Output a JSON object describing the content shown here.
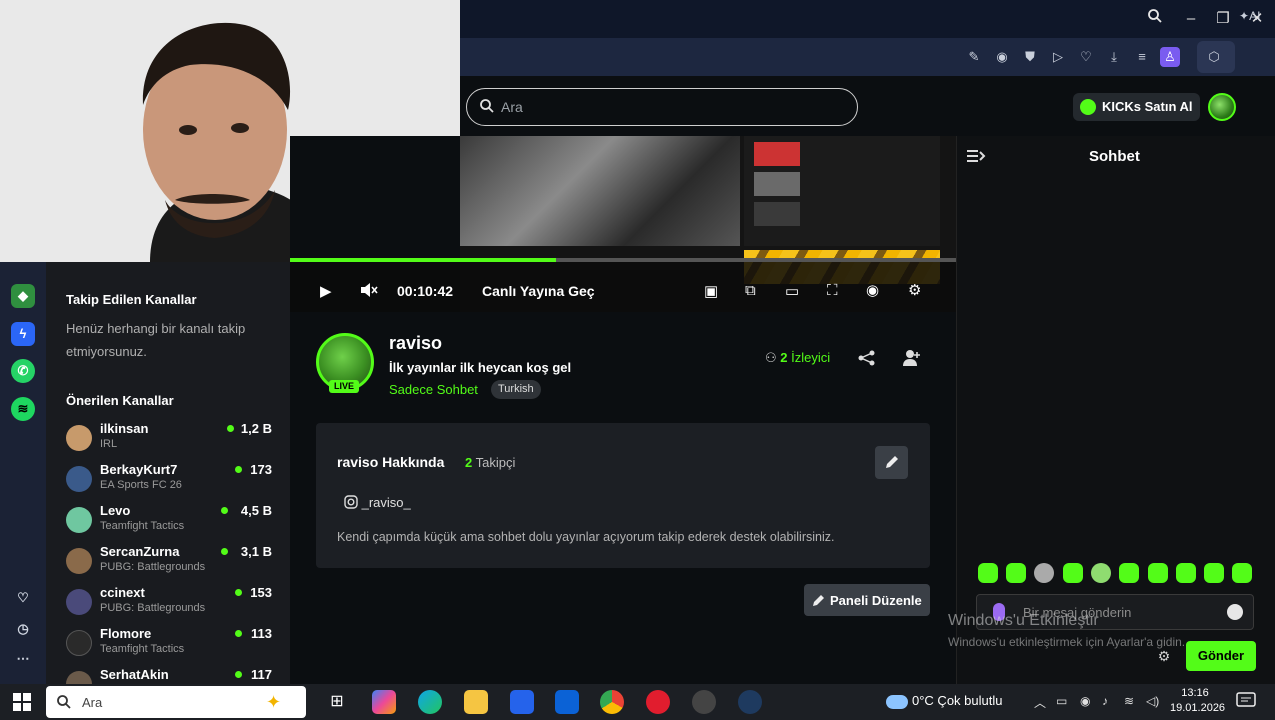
{
  "browser": {
    "toolbar_ai_label": "AI"
  },
  "header": {
    "search_placeholder": "Ara",
    "kicks_button": "KICKs Satın Al"
  },
  "player": {
    "time": "00:10:42",
    "go_live": "Canlı Yayına Geç",
    "progress_fraction": 0.4
  },
  "sidebar": {
    "followed_title": "Takip Edilen Kanallar",
    "followed_empty": "Henüz herhangi bir kanalı takip etmiyorsunuz.",
    "recommended_title": "Önerilen Kanallar",
    "channels": [
      {
        "name": "ilkinsan",
        "category": "IRL",
        "viewers": "1,2 B",
        "color": "#c79a6b"
      },
      {
        "name": "BerkayKurt7",
        "category": "EA Sports FC 26",
        "viewers": "173",
        "color": "#3a5a8a"
      },
      {
        "name": "Levo",
        "category": "Teamfight Tactics",
        "viewers": "4,5 B",
        "color": "#6fc7a0"
      },
      {
        "name": "SercanZurna",
        "category": "PUBG: Battlegrounds",
        "viewers": "3,1 B",
        "color": "#8a6a4a"
      },
      {
        "name": "ccinext",
        "category": "PUBG: Battlegrounds",
        "viewers": "153",
        "color": "#4a4a7a"
      },
      {
        "name": "Flomore",
        "category": "Teamfight Tactics",
        "viewers": "113",
        "color": "#2a2a2a"
      },
      {
        "name": "SerhatAkin",
        "category": "",
        "viewers": "117",
        "color": "#6a5a4a"
      }
    ]
  },
  "channel": {
    "live_badge": "LIVE",
    "username": "raviso",
    "stream_title": "İlk yayınlar ilk heycan koş gel",
    "category": "Sadece Sohbet",
    "tag": "Turkish",
    "viewers_count": "2",
    "viewers_label": "İzleyici"
  },
  "about": {
    "title": "raviso Hakkında",
    "followers_count": "2",
    "followers_label": "Takipçi",
    "instagram": "_raviso_",
    "bio": "Kendi çapımda küçük ama sohbet dolu yayınlar açıyorum takip ederek destek olabilirsiniz.",
    "panel_button": "Paneli Düzenle"
  },
  "chat": {
    "title": "Sohbet",
    "input_placeholder": "Bir mesaj gönderin",
    "send_button": "Gönder",
    "watermark_title": "Windows'u Etkinleştir",
    "watermark_text": "Windows'u etkinleştirmek için Ayarlar'a gidin."
  },
  "taskbar": {
    "search_placeholder": "Ara",
    "weather": "0°C  Çok bulutlu",
    "time": "13:16",
    "date": "19.01.2026"
  },
  "colors": {
    "kick_green": "#53fc18",
    "background": "#0b0e11",
    "browser_toolbar": "#1d2740"
  }
}
